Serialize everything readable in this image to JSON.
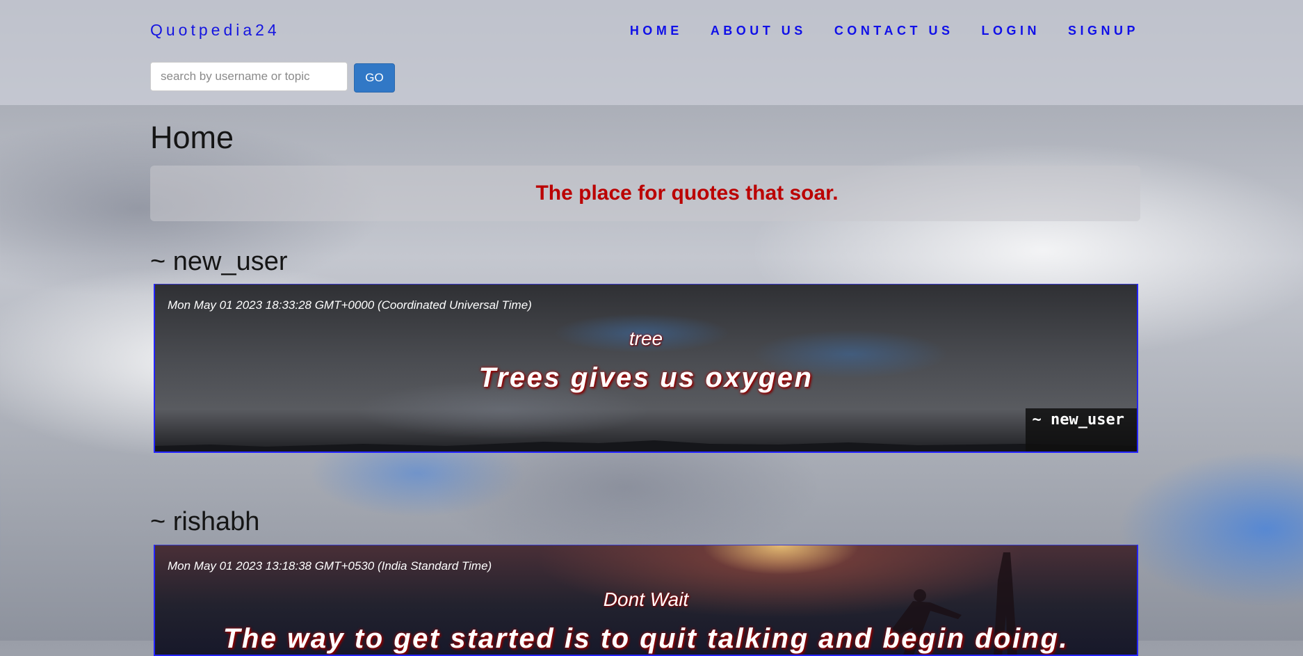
{
  "nav": {
    "brand": "Quotpedia24",
    "links": [
      "HOME",
      "ABOUT US",
      "CONTACT US",
      "LOGIN",
      "SIGNUP"
    ]
  },
  "search": {
    "placeholder": "search by username or topic",
    "value": "",
    "button_label": "GO"
  },
  "page": {
    "title": "Home",
    "tagline": "The place for quotes that soar."
  },
  "posts": [
    {
      "heading": "~ new_user",
      "date": "Mon May 01 2023 18:33:28 GMT+0000 (Coordinated Universal Time)",
      "topic": "tree",
      "quote": "Trees gives us oxygen",
      "author": "~ new_user"
    },
    {
      "heading": "~ rishabh",
      "date": "Mon May 01 2023 13:18:38 GMT+0530 (India Standard Time)",
      "topic": "Dont Wait",
      "quote": "The way to get started is to quit talking and begin doing."
    }
  ]
}
